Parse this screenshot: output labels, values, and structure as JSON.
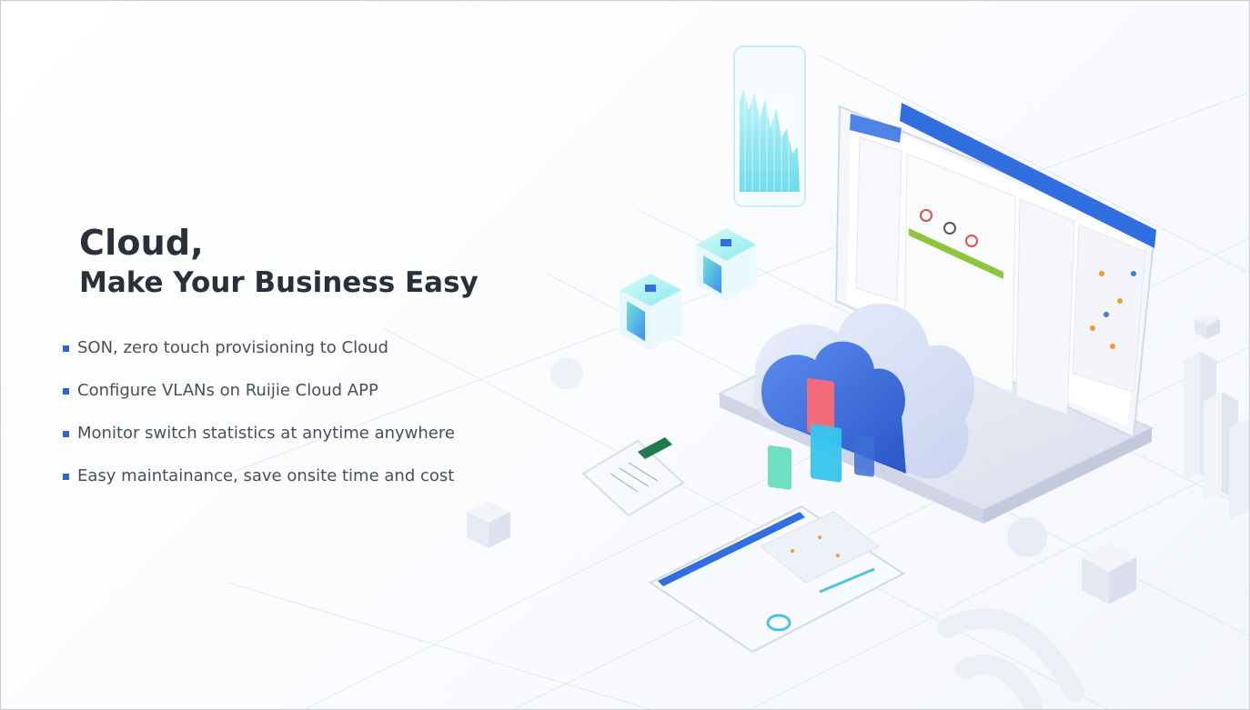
{
  "title": {
    "line1": "Cloud,",
    "line2": "Make Your Business Easy"
  },
  "bullets": [
    {
      "text": "SON, zero touch provisioning to Cloud"
    },
    {
      "text": "Configure VLANs on Ruijie Cloud APP"
    },
    {
      "text": "Monitor switch statistics at anytime anywhere"
    },
    {
      "text": "Easy maintainance, save onsite time and cost"
    }
  ],
  "colors": {
    "title": "#2a2f3a",
    "bullet_text": "#4a4f57",
    "bullet_mark": "#2e64d6",
    "accent_blue": "#2f6fe0",
    "teal": "#4ed6e6"
  },
  "icons": [
    "laptop-icon",
    "cloud-icon",
    "server-cube-icon",
    "chart-panel-icon",
    "phone-icon",
    "tablet-icon",
    "wifi-icon"
  ]
}
